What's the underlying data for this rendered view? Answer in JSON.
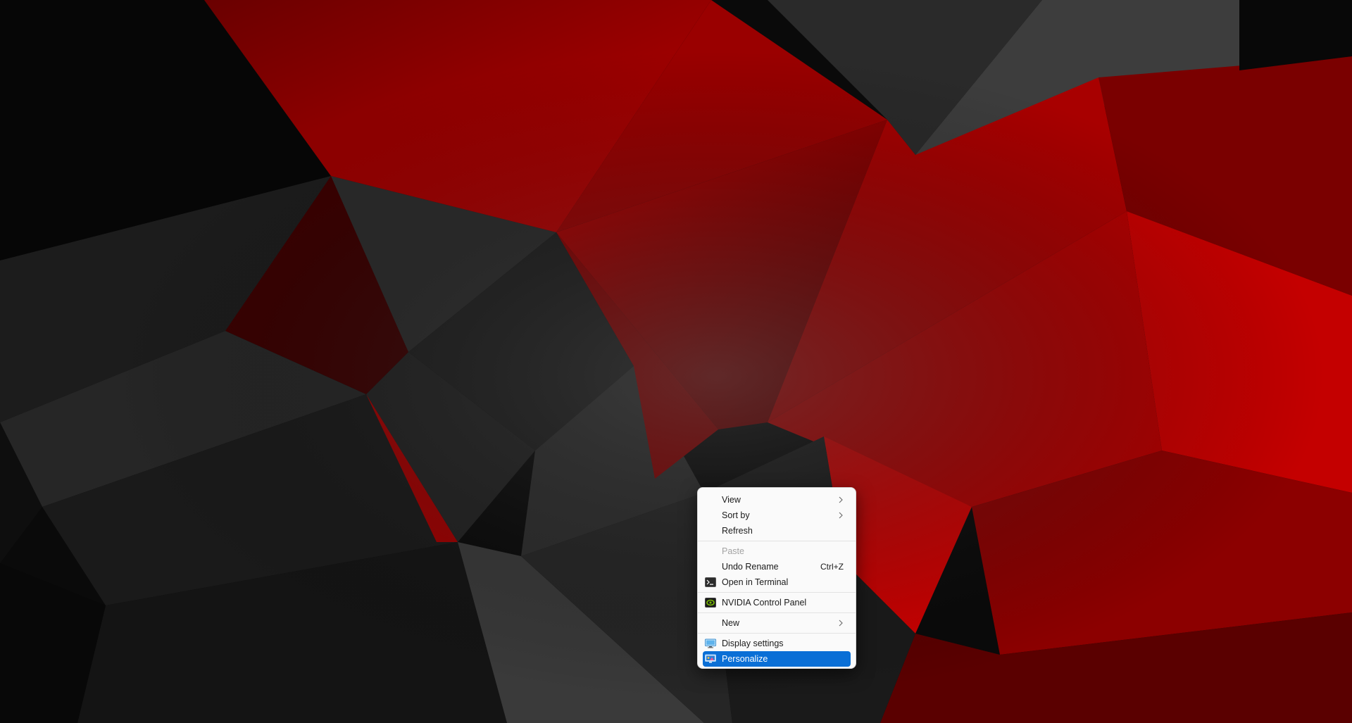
{
  "context_menu": {
    "items": [
      {
        "label": "View",
        "icon": "",
        "submenu": true
      },
      {
        "label": "Sort by",
        "icon": "",
        "submenu": true
      },
      {
        "label": "Refresh",
        "icon": ""
      },
      {
        "label": "Paste",
        "icon": "",
        "disabled": true
      },
      {
        "label": "Undo Rename",
        "shortcut": "Ctrl+Z",
        "icon": ""
      },
      {
        "label": "Open in Terminal",
        "icon": "terminal-icon"
      },
      {
        "label": "NVIDIA Control Panel",
        "icon": "nvidia-icon"
      },
      {
        "label": "New",
        "icon": "",
        "submenu": true
      },
      {
        "label": "Display settings",
        "icon": "display-icon"
      },
      {
        "label": "Personalize",
        "icon": "personalize-icon",
        "highlighted": true
      }
    ],
    "highlight_color": "#0a6fd6"
  },
  "wallpaper": {
    "description_colors": [
      "#000000",
      "#b00000",
      "#2a2a2a"
    ]
  }
}
